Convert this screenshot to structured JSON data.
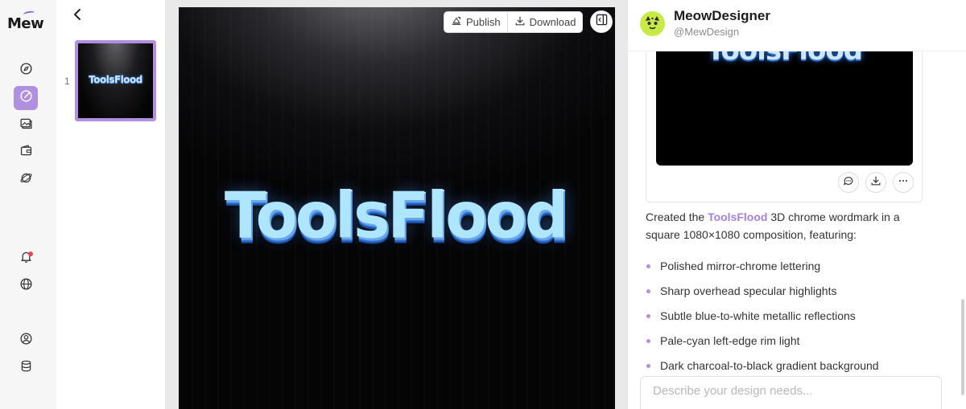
{
  "app": {
    "logo_text": "Mew"
  },
  "rail": {
    "items": [
      {
        "name": "explore",
        "icon": "compass-icon"
      },
      {
        "name": "design",
        "icon": "palette-icon",
        "active": true
      },
      {
        "name": "gallery",
        "icon": "image-gallery-icon"
      },
      {
        "name": "wallet",
        "icon": "wallet-icon"
      },
      {
        "name": "planet",
        "icon": "planet-icon"
      },
      {
        "name": "notifications",
        "icon": "bell-icon",
        "has_badge": true
      },
      {
        "name": "language",
        "icon": "globe-icon"
      },
      {
        "name": "profile",
        "icon": "user-circle-icon"
      },
      {
        "name": "storage",
        "icon": "database-icon"
      }
    ]
  },
  "pages": {
    "items": [
      {
        "number": "1",
        "thumb_text": "ToolsFlood"
      }
    ]
  },
  "canvas": {
    "wordmark": "ToolsFlood",
    "toolbar": {
      "publish_label": "Publish",
      "download_label": "Download"
    }
  },
  "chat": {
    "user_name": "MeowDesigner",
    "user_handle": "@MewDesign",
    "result_image_text": "ToolsFlood",
    "message_prefix": "Created the ",
    "message_highlight": "ToolsFlood",
    "message_suffix": " 3D chrome wordmark in a square 1080×1080 composition, featuring:",
    "features": [
      "Polished mirror-chrome lettering",
      "Sharp overhead specular highlights",
      "Subtle blue-to-white metallic reflections",
      "Pale-cyan left-edge rim light",
      "Dark charcoal-to-black gradient background"
    ],
    "input_placeholder": "Describe your design needs..."
  },
  "colors": {
    "accent": "#b18fe0",
    "highlight_text": "#a681dc",
    "avatar_bg": "#c7ea46",
    "canvas_bg": "#050506"
  }
}
